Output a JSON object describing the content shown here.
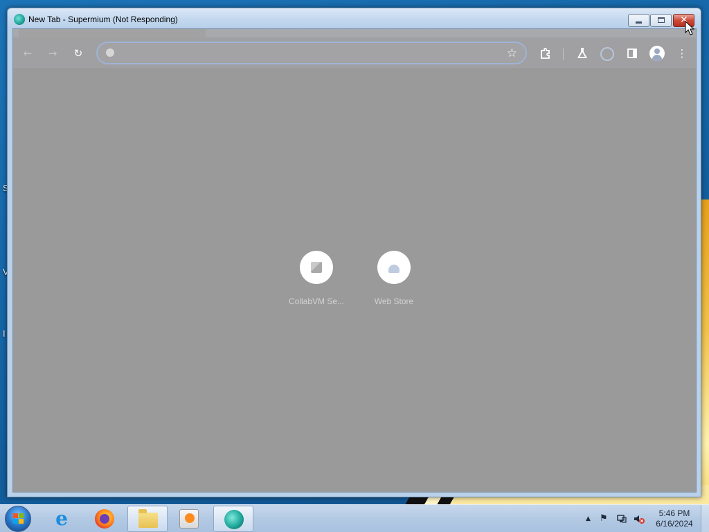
{
  "window": {
    "title": "New Tab - Supermium (Not Responding)",
    "minimize_icon": "minimize-icon",
    "maximize_icon": "maximize-icon",
    "close_icon": "close-icon"
  },
  "toolbar": {
    "back_icon": "arrow-left-icon",
    "forward_icon": "arrow-right-icon",
    "reload_icon": "reload-icon",
    "omnibox_value": "",
    "bookmark_icon": "star-icon",
    "extensions_icon": "puzzle-icon",
    "labs_icon": "flask-icon",
    "side_panel_icon": "side-panel-icon",
    "profile_icon": "avatar-icon",
    "menu_icon": "kebab-menu-icon"
  },
  "shortcuts": [
    {
      "label": "CollabVM Se...",
      "icon": "collabvm-favicon"
    },
    {
      "label": "Web Store",
      "icon": "webstore-favicon"
    }
  ],
  "taskbar": {
    "start": "windows-start-icon",
    "pinned": [
      "internet-explorer-icon",
      "firefox-icon",
      "file-explorer-icon",
      "media-player-icon",
      "supermium-icon"
    ],
    "tray": {
      "show_hidden": "▲",
      "clock_time": "5:46 PM",
      "clock_date": "6/16/2024"
    }
  },
  "desktop": {
    "fragments": [
      "S",
      "V",
      "I"
    ]
  },
  "colors": {
    "dimmed_content": "#9a9a9a",
    "titlebar": "#c4d9ef",
    "close_button": "#cf4a36",
    "taskbar": "#b3c9e3"
  }
}
